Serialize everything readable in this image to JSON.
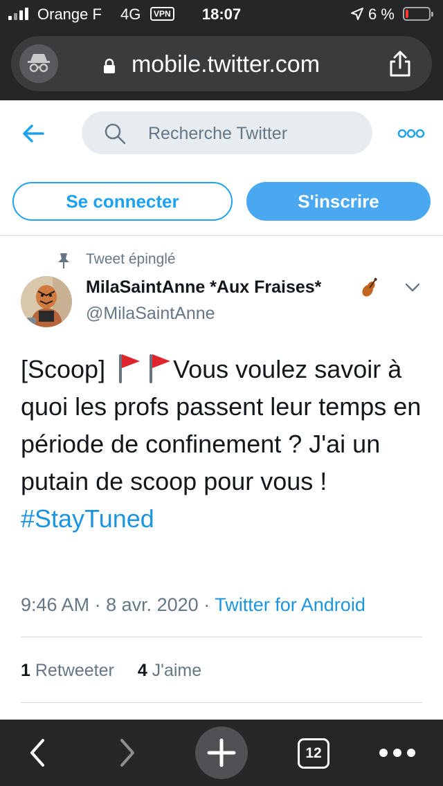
{
  "status_bar": {
    "carrier": "Orange F",
    "network": "4G",
    "vpn": "VPN",
    "time": "18:07",
    "battery": "6 %",
    "battery_level": 0.06,
    "battery_color": "#ff3b30"
  },
  "browser": {
    "url": "mobile.twitter.com",
    "icons": [
      "incognito-icon",
      "lock-icon",
      "share-icon"
    ]
  },
  "twitter_header": {
    "search_placeholder": "Recherche Twitter",
    "login_label": "Se connecter",
    "signup_label": "S'inscrire",
    "accent": "#1da1f2"
  },
  "tweet": {
    "pinned_label": "Tweet épinglé",
    "author_name": "MilaSaintAnne *Aux Fraises*",
    "author_handle": "@MilaSaintAnne",
    "text_start": "[Scoop]",
    "text_main": "Vous voulez savoir à quoi les profs passent leur temps en période de confinement ? J'ai un putain de scoop pour vous !",
    "hashtag": "#StayTuned",
    "time": "9:46 AM",
    "date": "8 avr. 2020",
    "separator": "·",
    "source": "Twitter for Android",
    "retweet_count": "1",
    "retweet_label": "Retweeter",
    "like_count": "4",
    "like_label": "J'aime"
  },
  "bottom_toolbar": {
    "tab_count": "12",
    "icons": [
      "back-icon",
      "forward-icon",
      "new-tab-icon",
      "tabs-icon",
      "more-icon"
    ]
  }
}
